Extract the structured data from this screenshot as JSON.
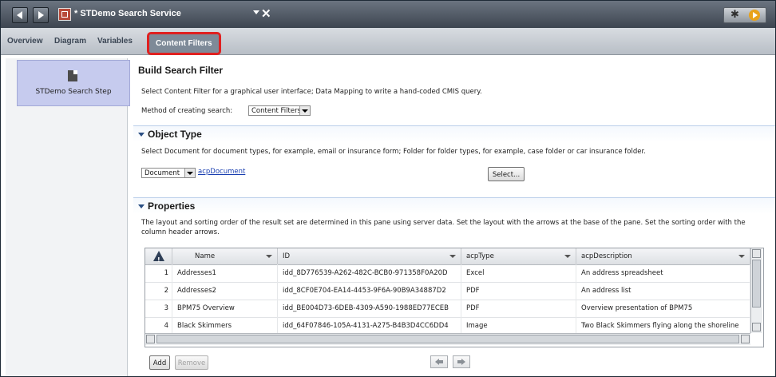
{
  "window": {
    "title": "* STDemo Search Service"
  },
  "tabs": [
    {
      "label": "Overview"
    },
    {
      "label": "Diagram"
    },
    {
      "label": "Variables"
    },
    {
      "label": "Content Filters"
    }
  ],
  "left_panel": {
    "step_label": "STDemo Search Step"
  },
  "build": {
    "title": "Build Search Filter",
    "description": "Select Content Filter for a graphical user interface; Data Mapping to write a hand-coded CMIS query.",
    "method_label": "Method of creating search:",
    "method_value": "Content Filters"
  },
  "object_type": {
    "title": "Object Type",
    "description": "Select Document for document types, for example, email or insurance form; Folder for folder types, for example, case folder or car insurance folder.",
    "type_value": "Document",
    "link": "acpDocument",
    "select_button": "Select..."
  },
  "properties": {
    "title": "Properties",
    "description_line1": "The layout and sorting order of the result set are determined in this pane using server data. Set the layout with the arrows at the base of the pane. Set the sorting order with the",
    "description_line2": "column header arrows.",
    "columns": [
      "Name",
      "ID",
      "acpType",
      "acpDescription"
    ],
    "rows": [
      {
        "num": "1",
        "name": "Addresses1",
        "id": "idd_8D776539-A262-482C-BCB0-971358F0A20D",
        "type": "Excel",
        "desc": "An address spreadsheet"
      },
      {
        "num": "2",
        "name": "Addresses2",
        "id": "idd_8CF0E704-EA14-4453-9F6A-90B9A34887D2",
        "type": "PDF",
        "desc": "An address list"
      },
      {
        "num": "3",
        "name": "BPM75 Overview",
        "id": "idd_BE004D73-6DEB-4309-A590-1988ED77ECEB",
        "type": "PDF",
        "desc": "Overview presentation of BPM75"
      },
      {
        "num": "4",
        "name": "Black Skimmers",
        "id": "idd_64F07846-105A-4131-A275-B4B3D4CC6DD4",
        "type": "Image",
        "desc": "Two Black Skimmers flying along the shoreline"
      }
    ],
    "add_button": "Add",
    "remove_button": "Remove"
  },
  "colors": {
    "highlight_border": "#e02020",
    "active_tab": "#7e8a98",
    "step_box": "#c6cbee",
    "link": "#1a3fb0"
  }
}
